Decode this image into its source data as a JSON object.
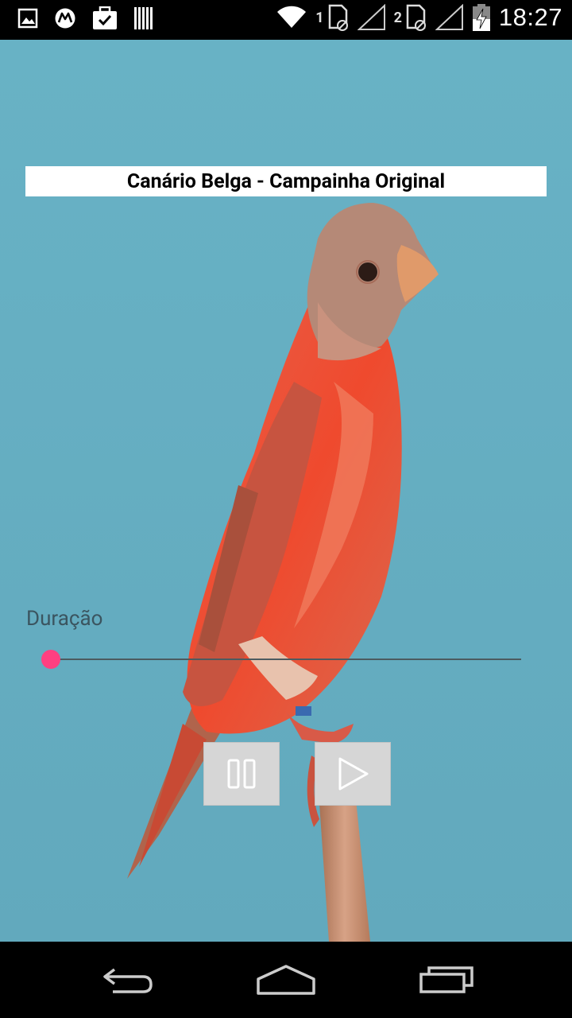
{
  "status_bar": {
    "time": "18:27",
    "sim1_label": "1",
    "sim2_label": "2",
    "icons_left": [
      "image-notification-icon",
      "motorola-icon",
      "briefcase-check-icon",
      "barcode-icon"
    ],
    "icons_right": [
      "wifi-icon",
      "sim1-icon",
      "signal1-icon",
      "sim2-icon",
      "signal2-icon",
      "battery-charging-icon"
    ]
  },
  "app": {
    "title": "Canário Belga - Campainha Original",
    "duration_label": "Duração",
    "seek_progress": 0,
    "pause_button": "pause-icon",
    "play_button": "play-icon",
    "accent_color": "#ff4081",
    "background_color": "#6db3c6"
  },
  "nav_bar": {
    "buttons": [
      "back-icon",
      "home-icon",
      "recent-apps-icon"
    ]
  }
}
